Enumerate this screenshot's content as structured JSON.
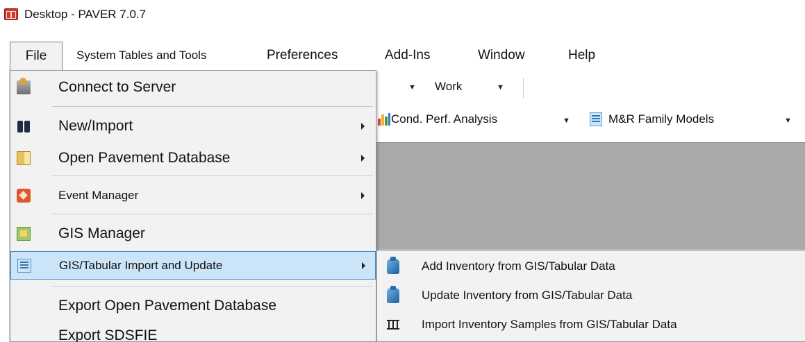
{
  "window": {
    "title": "Desktop - PAVER 7.0.7"
  },
  "menubar": {
    "items": [
      "File",
      "System Tables and Tools",
      "Preferences",
      "Add-Ins",
      "Window",
      "Help"
    ]
  },
  "toolbar": {
    "row1_work": "Work",
    "row2_cond_perf": "Cond. Perf. Analysis",
    "row2_mr_models": "M&R Family Models"
  },
  "file_menu": {
    "items": [
      {
        "label": "Connect to Server",
        "icon": "server-icon",
        "has_submenu": false
      },
      {
        "label": "New/Import",
        "icon": "binoculars-icon",
        "has_submenu": true
      },
      {
        "label": "Open Pavement Database",
        "icon": "database-icon",
        "has_submenu": true
      },
      {
        "label": "Event Manager",
        "icon": "event-icon",
        "has_submenu": true
      },
      {
        "label": "GIS Manager",
        "icon": "gis-icon",
        "has_submenu": false
      },
      {
        "label": "GIS/Tabular Import and Update",
        "icon": "gis-tabular-icon",
        "has_submenu": true,
        "highlighted": true
      },
      {
        "label": "Export Open Pavement Database",
        "icon": "",
        "has_submenu": false
      },
      {
        "label": "Export SDSFIE",
        "icon": "",
        "has_submenu": false
      }
    ]
  },
  "gis_submenu": {
    "items": [
      {
        "label": "Add Inventory from GIS/Tabular Data",
        "icon": "flask-icon"
      },
      {
        "label": "Update Inventory from GIS/Tabular Data",
        "icon": "flask-icon"
      },
      {
        "label": "Import Inventory Samples from GIS/Tabular Data",
        "icon": "samples-icon"
      }
    ]
  },
  "colors": {
    "menu_bg": "#f2f2f2",
    "highlight_bg": "#cce4f7",
    "highlight_border": "#3c8ad3",
    "workspace_gray": "#a9a9a9"
  }
}
